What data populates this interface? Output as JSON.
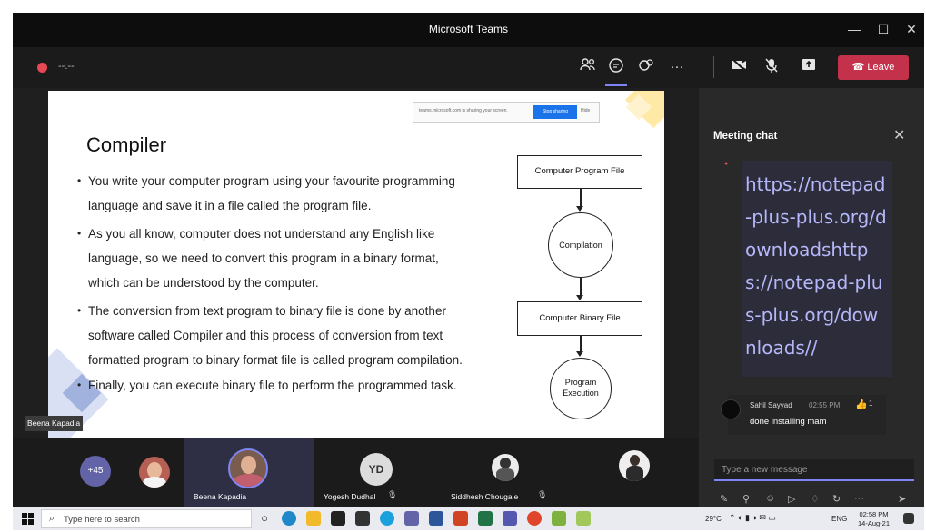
{
  "window": {
    "title": "Microsoft Teams",
    "minimize": "—",
    "maximize": "☐",
    "close": "✕"
  },
  "toolbar": {
    "timer": "--:--",
    "leave_label": "Leave",
    "icons": [
      "people-icon",
      "chat-icon",
      "reactions-icon",
      "more-icon",
      "camera-off-icon",
      "mic-off-icon",
      "share-icon"
    ]
  },
  "share_bar": {
    "text": "teams.microsoft.com is sharing your screen.",
    "stop_label": "Stop sharing",
    "hide_label": "Hide"
  },
  "slide": {
    "title": "Compiler",
    "bullets": [
      [
        "You write your computer program using your favourite programming",
        "language and save it in a file called the program file."
      ],
      [
        "As you all know, computer does not understand any English like",
        "language, so we need to convert this program in a binary format,",
        "which can be understood by the computer."
      ],
      [
        "The conversion from text program to binary file is done by another",
        "software called Compiler and this process of conversion from text",
        "formatted program to binary format file is called program compilation."
      ],
      [
        "Finally, you can execute binary file to perform the programmed task."
      ]
    ],
    "flow": {
      "box1": "Computer Program File",
      "circle1": "Compilation",
      "box2": "Computer Binary File",
      "circle2_line1": "Program",
      "circle2_line2": "Execution"
    }
  },
  "presenter_tag": "Beena Kapadia",
  "chat": {
    "title": "Meeting chat",
    "message_link": "https://notepad-plus-plus.org/downloadshttps://notepad-plus-plus.org/downloads//",
    "reply": {
      "name": "Sahil Sayyad",
      "time": "02:55 PM",
      "reaction_count": "1",
      "text": "done installing mam"
    },
    "compose_placeholder": "Type a new message"
  },
  "participants": {
    "overflow": "+45",
    "tiles": [
      {
        "name": "Beena Kapadia"
      },
      {
        "name": "Yogesh Dudhal",
        "initials": "YD"
      },
      {
        "name": "Siddhesh Chougale"
      }
    ]
  },
  "taskbar": {
    "search_placeholder": "Type here to search",
    "weather": "29°C",
    "lang": "ENG",
    "time": "02:58 PM",
    "date": "14-Aug-21"
  },
  "colors": {
    "accent": "#7f85f5",
    "leave": "#c4314b",
    "link": "#b4b7f9"
  }
}
